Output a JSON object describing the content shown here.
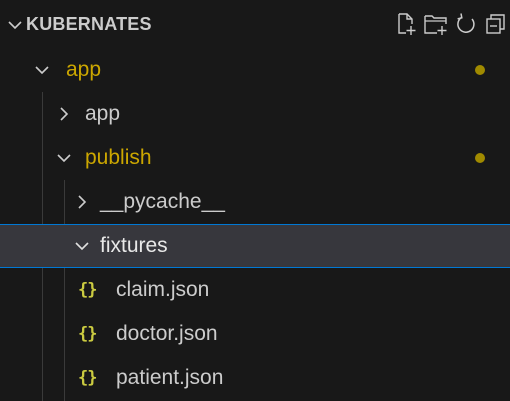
{
  "header": {
    "title": "KUBERNATES",
    "chevron_icon": "chevron-down-icon",
    "actions": [
      {
        "name": "new-file-icon"
      },
      {
        "name": "new-folder-icon"
      },
      {
        "name": "refresh-icon"
      },
      {
        "name": "collapse-all-icon"
      }
    ]
  },
  "colors": {
    "modified": "#cca700",
    "folder_text": "#cccccc",
    "selection_border": "#0078d4",
    "selection_bg": "#37373d",
    "json_icon": "#cbcb41"
  },
  "tree": {
    "app_root": {
      "label": "app",
      "expanded": true,
      "modified": true
    },
    "app_child": {
      "label": "app",
      "expanded": false
    },
    "publish": {
      "label": "publish",
      "expanded": true,
      "modified": true
    },
    "pycache": {
      "label": "__pycache__",
      "expanded": false
    },
    "fixtures": {
      "label": "fixtures",
      "expanded": true,
      "selected": true
    },
    "files": [
      {
        "label": "claim.json",
        "icon": "json-icon",
        "icon_text": "{}"
      },
      {
        "label": "doctor.json",
        "icon": "json-icon",
        "icon_text": "{}"
      },
      {
        "label": "patient.json",
        "icon": "json-icon",
        "icon_text": "{}"
      }
    ]
  }
}
